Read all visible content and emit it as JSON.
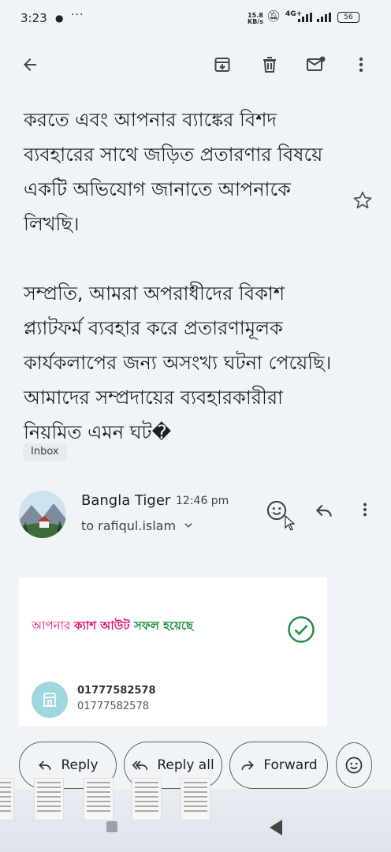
{
  "status_bar": {
    "time": "3:23",
    "speed_value": "15.8",
    "speed_unit": "KB/s",
    "network": "4G+",
    "battery": "56"
  },
  "email": {
    "paragraphs": [
      "করতে এবং আপনার ব্যাঙ্কের বিশদ ব্যবহারের সাথে জড়িত প্রতারণার বিষয়ে একটি অভিযোগ জানাতে আপনাকে লিখছি।",
      "সম্প্রতি, আমরা অপরাধীদের বিকাশ প্ল্যাটফর্ম ব্যবহার করে প্রতারণামূলক কার্যকলাপের জন্য অসংখ্য ঘটনা পেয়েছি। আমাদের সম্প্রদায়ের ব্যবহারকারীরা নিয়মিত এমন ঘট�"
    ],
    "label": "Inbox",
    "sender_name": "Bangla Tiger",
    "time": "12:46 pm",
    "recipient": "to rafiqul.islam"
  },
  "card": {
    "msg_prefix": "আপনার ",
    "msg_bold": "ক্যাশ আউট",
    "msg_success": " সফল হয়েছে",
    "number_primary": "01777582578",
    "number_secondary": "01777582578"
  },
  "actions": {
    "reply": "Reply",
    "reply_all": "Reply all",
    "forward": "Forward"
  },
  "colors": {
    "pink": "#e2136e",
    "green": "#1e8e3e",
    "background": "#f0f4f9"
  },
  "icons": [
    "back-arrow-icon",
    "archive-icon",
    "delete-icon",
    "mark-unread-icon",
    "more-vert-icon",
    "star-icon",
    "emoji-icon",
    "reply-icon",
    "reply-all-icon",
    "forward-icon",
    "check-circle-icon"
  ]
}
